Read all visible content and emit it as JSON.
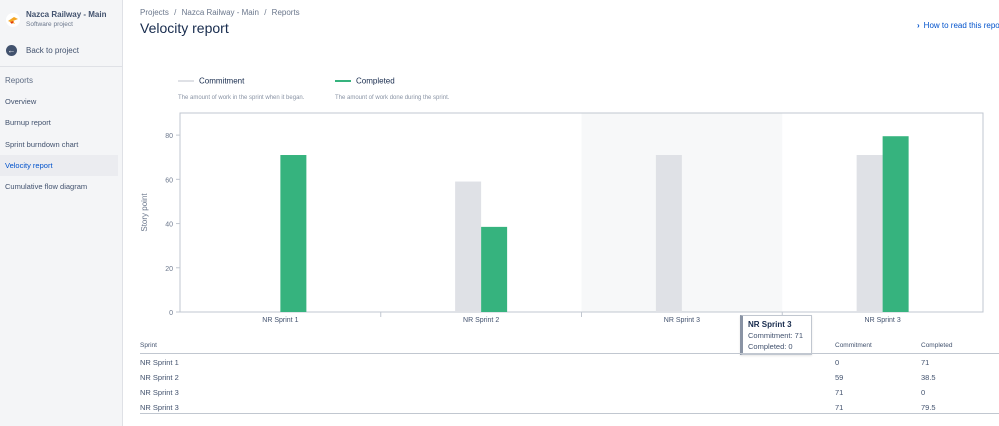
{
  "sidebar": {
    "project_name": "Nazca Railway - Main",
    "project_type": "Software project",
    "back_label": "Back to project",
    "section": "Reports",
    "items": [
      {
        "label": "Overview",
        "active": false
      },
      {
        "label": "Burnup report",
        "active": false
      },
      {
        "label": "Sprint burndown chart",
        "active": false
      },
      {
        "label": "Velocity report",
        "active": true
      },
      {
        "label": "Cumulative flow diagram",
        "active": false
      }
    ]
  },
  "header": {
    "breadcrumbs": [
      "Projects",
      "/",
      "Nazca Railway - Main",
      "/",
      "Reports"
    ],
    "title": "Velocity report",
    "howto": "How to read this report"
  },
  "legend": [
    {
      "name": "Commitment",
      "description": "The amount of work in the sprint when it began.",
      "color": "#dfe1e6"
    },
    {
      "name": "Completed",
      "description": "The amount of work done during the sprint.",
      "color": "#36b37e"
    }
  ],
  "chart_data": {
    "type": "bar",
    "categories": [
      "NR Sprint 1",
      "NR Sprint 2",
      "NR Sprint 3",
      "NR Sprint 3"
    ],
    "series": [
      {
        "name": "Commitment",
        "values": [
          0,
          59,
          71,
          71
        ],
        "color": "#dfe1e6"
      },
      {
        "name": "Completed",
        "values": [
          71,
          38.5,
          0,
          79.5
        ],
        "color": "#36b37e"
      }
    ],
    "ylabel": "Story point",
    "yticks": [
      0,
      20,
      40,
      60,
      80
    ],
    "ylim": [
      0,
      90
    ],
    "highlight_category": 2,
    "grid": false
  },
  "tooltip": {
    "title": "NR Sprint 3",
    "commitment": "Commitment: 71",
    "completed": "Completed: 0"
  },
  "table": {
    "headers": [
      "Sprint",
      "Commitment",
      "Completed"
    ],
    "rows": [
      [
        "NR Sprint 1",
        "0",
        "71"
      ],
      [
        "NR Sprint 2",
        "59",
        "38.5"
      ],
      [
        "NR Sprint 3",
        "71",
        "0"
      ],
      [
        "NR Sprint 3",
        "71",
        "79.5"
      ]
    ]
  }
}
